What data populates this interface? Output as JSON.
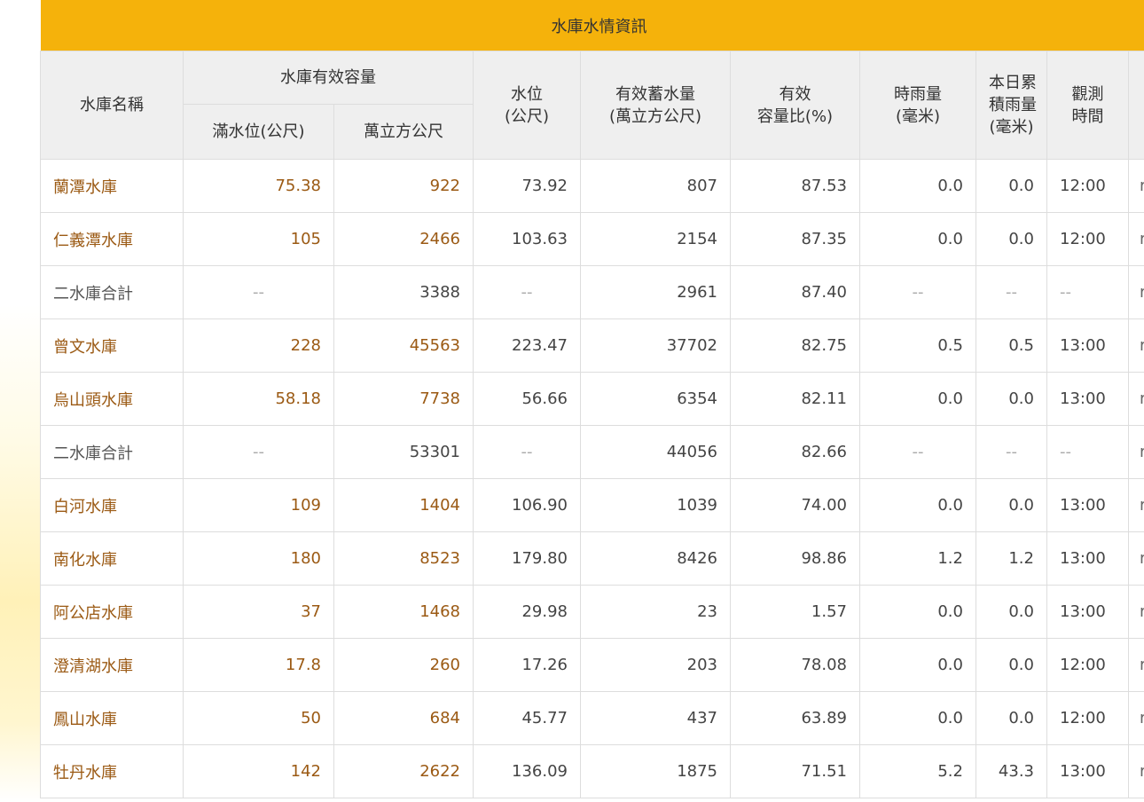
{
  "table": {
    "title": "水庫水情資訊",
    "headers": {
      "name": "水庫名稱",
      "effective_capacity": "水庫有效容量",
      "full_level": "滿水位(公尺)",
      "capacity_10k_m3": "萬立方公尺",
      "water_level_1": "水位",
      "water_level_2": "(公尺)",
      "storage_1": "有效蓄水量",
      "storage_2": "(萬立方公尺)",
      "ratio_1": "有效",
      "ratio_2": "容量比(%)",
      "hourly_rain_1": "時雨量",
      "hourly_rain_2": "(毫米)",
      "daily_rain_1": "本日累",
      "daily_rain_2": "積雨量",
      "daily_rain_3": "(毫米)",
      "obs_time_1": "觀測",
      "obs_time_2": "時間"
    },
    "rows": [
      {
        "name": "蘭潭水庫",
        "full": "75.38",
        "cap": "922",
        "level": "73.92",
        "storage": "807",
        "ratio": "87.53",
        "hourly": "0.0",
        "daily": "0.0",
        "time": "12:00",
        "extra": "r"
      },
      {
        "name": "仁義潭水庫",
        "full": "105",
        "cap": "2466",
        "level": "103.63",
        "storage": "2154",
        "ratio": "87.35",
        "hourly": "0.0",
        "daily": "0.0",
        "time": "12:00",
        "extra": "r"
      },
      {
        "name": "二水庫合計",
        "full": "--",
        "cap": "3388",
        "level": "--",
        "storage": "2961",
        "ratio": "87.40",
        "hourly": "--",
        "daily": "--",
        "time": "--",
        "extra": "r"
      },
      {
        "name": "曾文水庫",
        "full": "228",
        "cap": "45563",
        "level": "223.47",
        "storage": "37702",
        "ratio": "82.75",
        "hourly": "0.5",
        "daily": "0.5",
        "time": "13:00",
        "extra": "r"
      },
      {
        "name": "烏山頭水庫",
        "full": "58.18",
        "cap": "7738",
        "level": "56.66",
        "storage": "6354",
        "ratio": "82.11",
        "hourly": "0.0",
        "daily": "0.0",
        "time": "13:00",
        "extra": "r"
      },
      {
        "name": "二水庫合計",
        "full": "--",
        "cap": "53301",
        "level": "--",
        "storage": "44056",
        "ratio": "82.66",
        "hourly": "--",
        "daily": "--",
        "time": "--",
        "extra": "r"
      },
      {
        "name": "白河水庫",
        "full": "109",
        "cap": "1404",
        "level": "106.90",
        "storage": "1039",
        "ratio": "74.00",
        "hourly": "0.0",
        "daily": "0.0",
        "time": "13:00",
        "extra": "r"
      },
      {
        "name": "南化水庫",
        "full": "180",
        "cap": "8523",
        "level": "179.80",
        "storage": "8426",
        "ratio": "98.86",
        "hourly": "1.2",
        "daily": "1.2",
        "time": "13:00",
        "extra": "r"
      },
      {
        "name": "阿公店水庫",
        "full": "37",
        "cap": "1468",
        "level": "29.98",
        "storage": "23",
        "ratio": "1.57",
        "hourly": "0.0",
        "daily": "0.0",
        "time": "13:00",
        "extra": "r"
      },
      {
        "name": "澄清湖水庫",
        "full": "17.8",
        "cap": "260",
        "level": "17.26",
        "storage": "203",
        "ratio": "78.08",
        "hourly": "0.0",
        "daily": "0.0",
        "time": "12:00",
        "extra": "r"
      },
      {
        "name": "鳳山水庫",
        "full": "50",
        "cap": "684",
        "level": "45.77",
        "storage": "437",
        "ratio": "63.89",
        "hourly": "0.0",
        "daily": "0.0",
        "time": "12:00",
        "extra": "r"
      },
      {
        "name": "牡丹水庫",
        "full": "142",
        "cap": "2622",
        "level": "136.09",
        "storage": "1875",
        "ratio": "71.51",
        "hourly": "5.2",
        "daily": "43.3",
        "time": "13:00",
        "extra": "r"
      }
    ]
  },
  "colors": {
    "title_bar": "#f5b20b",
    "header_bg": "#efefef",
    "reservoir_text": "#9b5a14",
    "border": "#dddddd"
  }
}
